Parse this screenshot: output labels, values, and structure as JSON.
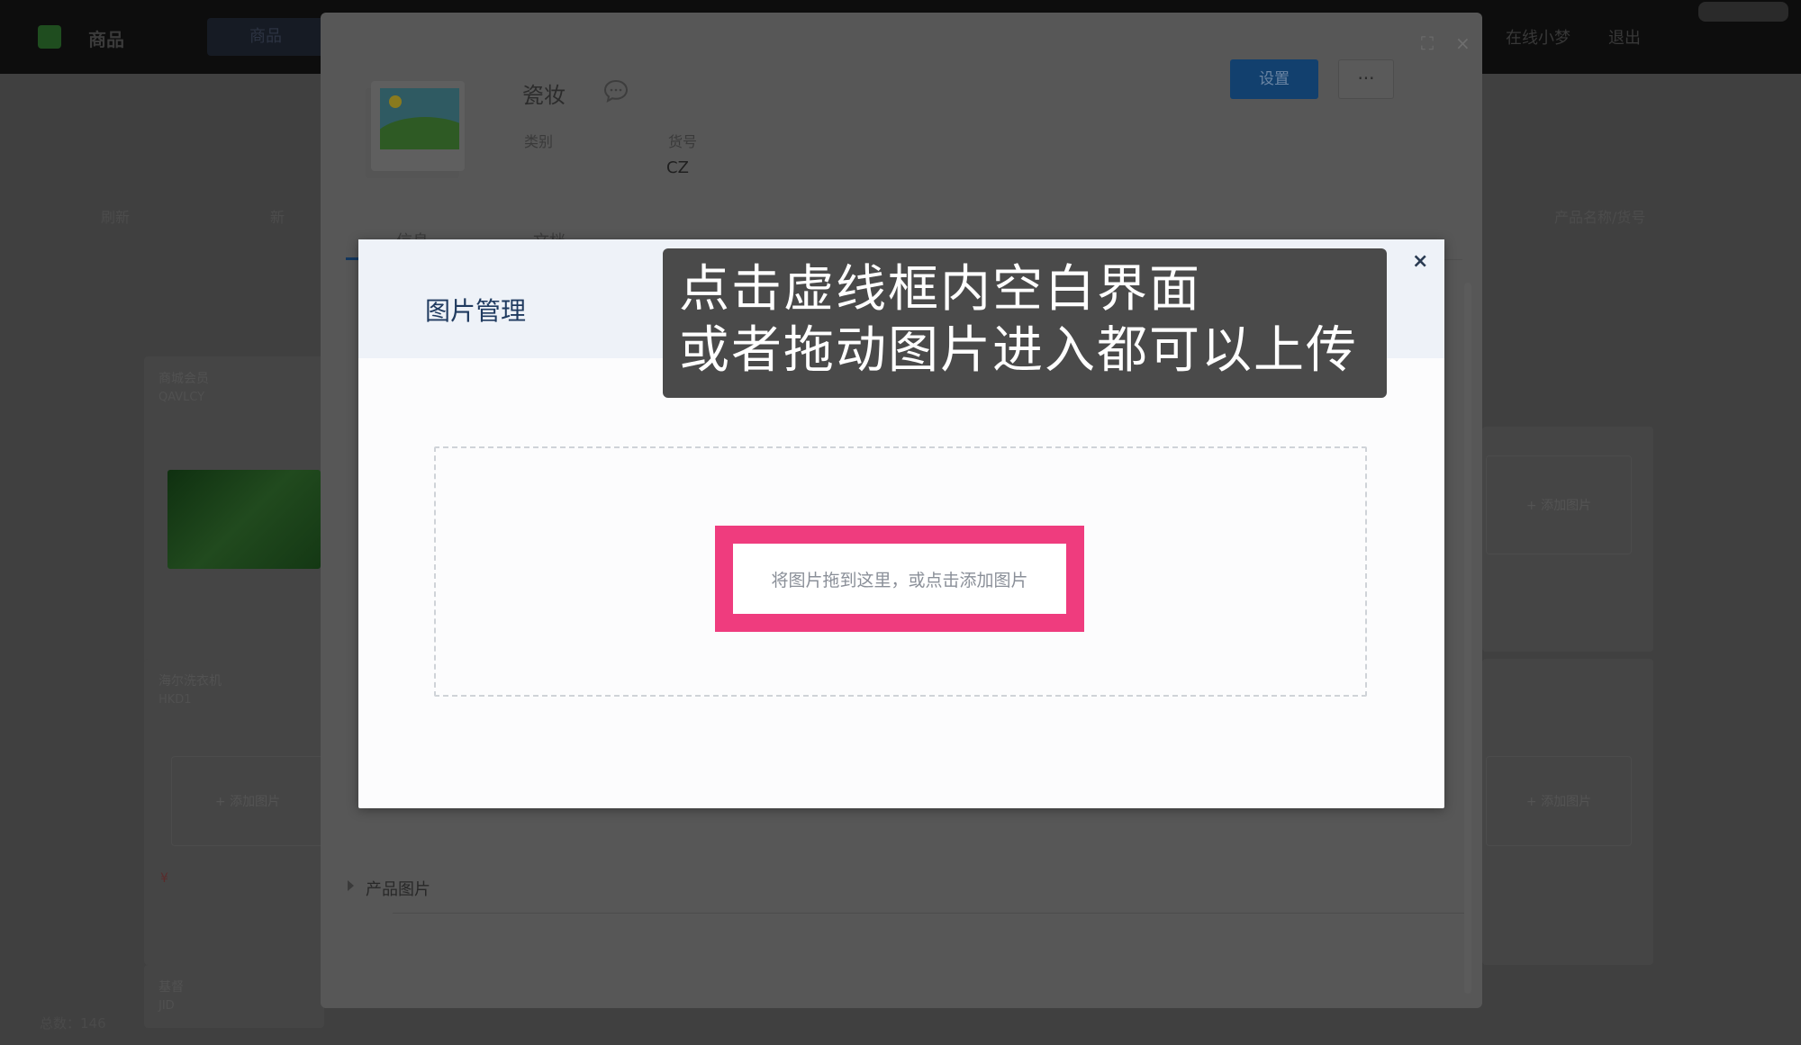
{
  "app": {
    "name": "商品",
    "active_tab": "商品",
    "top_right_a": "在线小梦",
    "top_right_b": "退出",
    "toolbar_refresh": "刷新",
    "toolbar_new": "新",
    "toolbar_search": "产品名称/货号",
    "footer_total": "总数：146"
  },
  "background_cards": [
    {
      "line1": "商城会员",
      "line2": "QAVLCY"
    },
    {
      "line1": "海尔洗衣机",
      "line2": "HKD1"
    },
    {
      "line1": "基督",
      "line2": "JID"
    }
  ],
  "background_add_image": "+ 添加图片",
  "detail": {
    "product_name": "瓷妆",
    "category_label": "类别",
    "sku_label": "货号",
    "sku_value": "CZ",
    "settings_button": "设置",
    "more_button": "···",
    "tab_info": "信息",
    "tab_docs": "文档",
    "section_product_images": "产品图片",
    "expand_icon": "⛶",
    "close_icon": "×"
  },
  "image_modal": {
    "title": "图片管理",
    "close_icon": "×",
    "drop_hint": "将图片拖到这里，或点击添加图片"
  },
  "caption": {
    "line1": "点击虚线框内空白界面",
    "line2": "或者拖动图片进入都可以上传"
  },
  "colors": {
    "accent": "#ef3c7e",
    "modal_header": "#eef2f8",
    "title_text": "#1f3a5f",
    "caption_bg": "#4a4a4a"
  }
}
